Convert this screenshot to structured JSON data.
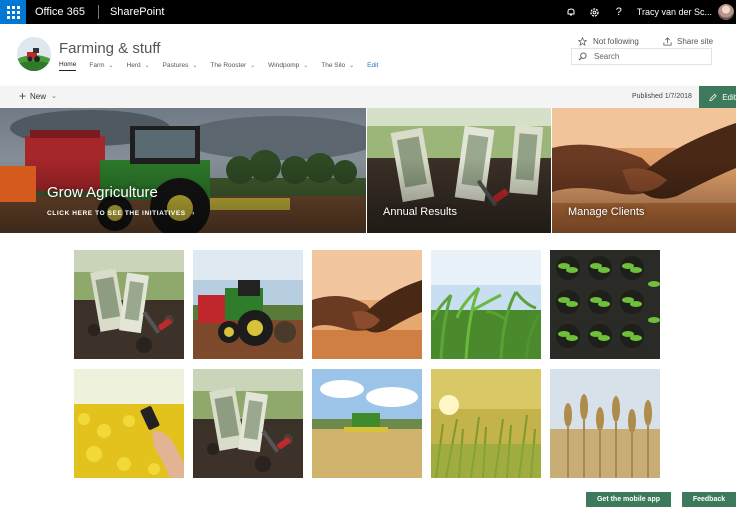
{
  "suite_bar": {
    "app_launcher": "waffle-icon",
    "brand": "Office 365",
    "app_name": "SharePoint",
    "icons": [
      "bell-icon",
      "gear-icon",
      "help-icon"
    ],
    "help_glyph": "?",
    "user_name": "Tracy van der Sc..."
  },
  "site": {
    "title": "Farming & stuff",
    "nav": [
      {
        "label": "Home",
        "active": true,
        "has_menu": false
      },
      {
        "label": "Farm",
        "active": false,
        "has_menu": true
      },
      {
        "label": "Herd",
        "active": false,
        "has_menu": true
      },
      {
        "label": "Pastures",
        "active": false,
        "has_menu": true
      },
      {
        "label": "The Rooster",
        "active": false,
        "has_menu": true
      },
      {
        "label": "Windpomp",
        "active": false,
        "has_menu": true
      },
      {
        "label": "The Silo",
        "active": false,
        "has_menu": true
      }
    ],
    "nav_edit": "Edit",
    "follow_label": "Not following",
    "share_label": "Share site",
    "search_placeholder": "Search"
  },
  "command_bar": {
    "new_label": "New",
    "published": "Published 1/7/2018",
    "edit_label": "Edit"
  },
  "hero": {
    "main_title": "Grow Agriculture",
    "main_link": "CLICK HERE TO SEE THE INITIATIVES",
    "tiles": [
      {
        "label": "Annual Results"
      },
      {
        "label": "Manage Clients"
      }
    ]
  },
  "gallery": {
    "rows": 2,
    "columns": 5,
    "images": [
      "money-in-soil",
      "red-green-tractor",
      "handshake",
      "corn-field",
      "seedlings",
      "phone-in-canola",
      "money-in-soil",
      "combine-harvester",
      "sunlit-grass",
      "wheat-ears"
    ]
  },
  "footer": {
    "mobile_app_label": "Get the mobile app",
    "feedback_label": "Feedback"
  },
  "colors": {
    "suite_bar": "#000000",
    "waffle": "#0078d4",
    "theme_green": "#3d7a5b",
    "accent_orange": "#d45a1e",
    "nav_edit_link": "#2a6ebb"
  }
}
